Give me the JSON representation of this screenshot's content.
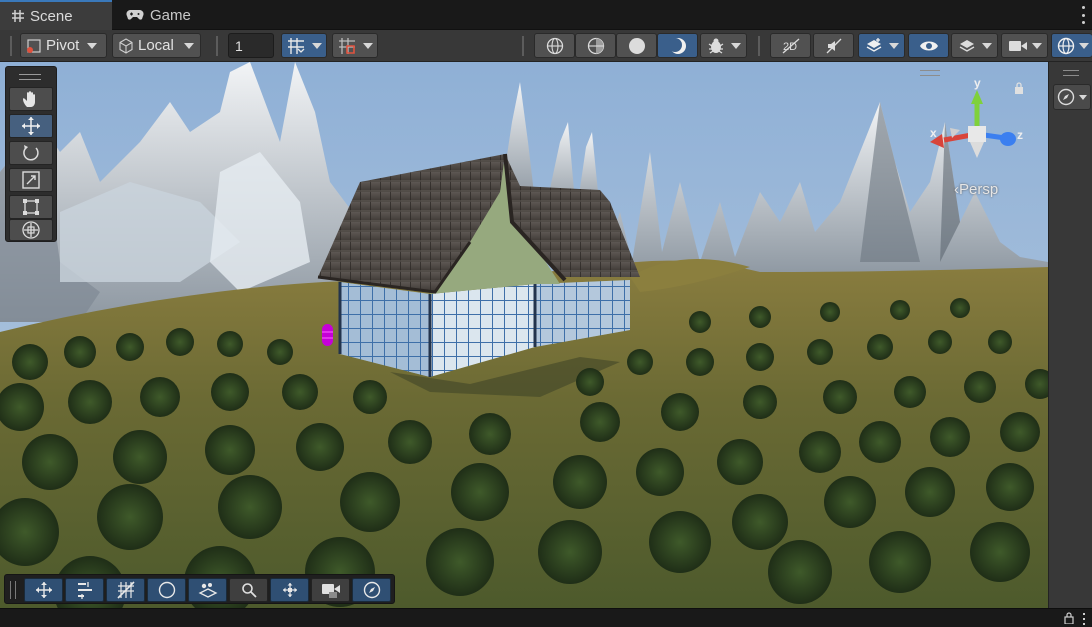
{
  "tabs": [
    {
      "label": "Scene",
      "icon": "grid-hash-icon",
      "active": true
    },
    {
      "label": "Game",
      "icon": "gamepad-icon",
      "active": false
    }
  ],
  "toolbar": {
    "pivot_label": "Pivot",
    "local_label": "Local",
    "grid_snap_value": "1",
    "grid_snap_placeholder": "1"
  },
  "tools": [
    {
      "name": "hand-tool",
      "icon": "hand-icon",
      "selected": false
    },
    {
      "name": "move-tool",
      "icon": "move-arrows-icon",
      "selected": true
    },
    {
      "name": "rotate-tool",
      "icon": "rotate-icon",
      "selected": false
    },
    {
      "name": "scale-tool",
      "icon": "scale-icon",
      "selected": false
    },
    {
      "name": "rect-tool",
      "icon": "rect-transform-icon",
      "selected": false
    },
    {
      "name": "transform-tool",
      "icon": "transform-combined-icon",
      "selected": false
    }
  ],
  "gizmo": {
    "x_label": "x",
    "y_label": "y",
    "z_label": "z",
    "projection_label": "Persp"
  },
  "colors": {
    "accent": "#3a79bb",
    "selected_button": "#3a5f8b",
    "x_axis": "#d8443a",
    "y_axis": "#7fd13b",
    "z_axis": "#3b7ff0"
  }
}
